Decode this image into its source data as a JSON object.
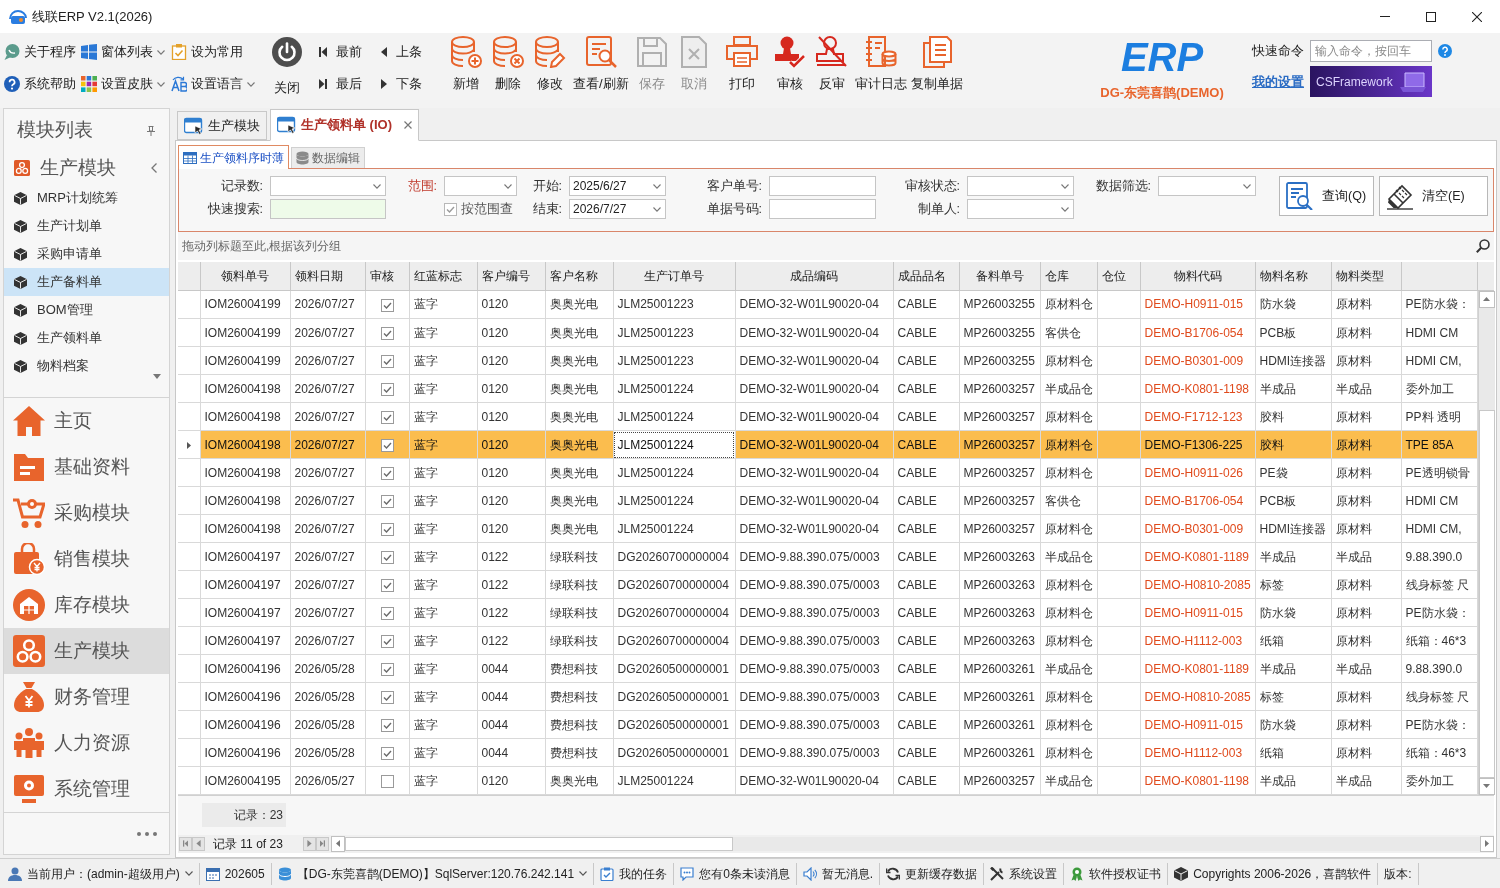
{
  "window": {
    "title": "线联ERP V2.1(2026)"
  },
  "toolbar": {
    "quick_buttons": [
      {
        "label": "关于程序",
        "dropdown": false
      },
      {
        "label": "窗体列表",
        "dropdown": true
      },
      {
        "label": "设为常用",
        "dropdown": false
      },
      {
        "label": "系统帮助",
        "dropdown": false
      },
      {
        "label": "设置皮肤",
        "dropdown": true
      },
      {
        "label": "设置语言",
        "dropdown": true
      }
    ],
    "close_button": {
      "label": "关闭"
    },
    "nav_buttons": [
      {
        "label": "最前"
      },
      {
        "label": "上条"
      },
      {
        "label": "最后"
      },
      {
        "label": "下条"
      }
    ],
    "action_buttons": [
      {
        "label": "新增",
        "disabled": false
      },
      {
        "label": "删除",
        "disabled": false
      },
      {
        "label": "修改",
        "disabled": false
      },
      {
        "label": "查看/刷新",
        "disabled": false
      },
      {
        "label": "保存",
        "disabled": true
      },
      {
        "label": "取消",
        "disabled": true
      },
      {
        "label": "打印",
        "disabled": false
      },
      {
        "label": "审核",
        "disabled": false
      },
      {
        "label": "反审",
        "disabled": false
      },
      {
        "label": "审计日志",
        "disabled": false
      },
      {
        "label": "复制单据",
        "disabled": false
      }
    ]
  },
  "brand": {
    "logo_text": "ERP",
    "company": "DG-东莞喜鹊(DEMO)"
  },
  "quick_command": {
    "label": "快速命令",
    "placeholder": "输入命令，按回车"
  },
  "settings_link": "我的设置",
  "banner": {
    "text": "CSFramework"
  },
  "sidebar": {
    "title": "模块列表",
    "group": {
      "label": "生产模块",
      "expanded": true
    },
    "items": [
      {
        "label": "MRP计划统筹",
        "selected": false
      },
      {
        "label": "生产计划单",
        "selected": false
      },
      {
        "label": "采购申请单",
        "selected": false
      },
      {
        "label": "生产备料单",
        "selected": true
      },
      {
        "label": "BOM管理",
        "selected": false
      },
      {
        "label": "生产领料单",
        "selected": false
      },
      {
        "label": "物料档案",
        "selected": false
      }
    ],
    "modules": [
      {
        "label": "主页",
        "selected": false
      },
      {
        "label": "基础资料",
        "selected": false
      },
      {
        "label": "采购模块",
        "selected": false
      },
      {
        "label": "销售模块",
        "selected": false
      },
      {
        "label": "库存模块",
        "selected": false
      },
      {
        "label": "生产模块",
        "selected": true
      },
      {
        "label": "财务管理",
        "selected": false
      },
      {
        "label": "人力资源",
        "selected": false
      },
      {
        "label": "系统管理",
        "selected": false
      }
    ]
  },
  "document_tabs": [
    {
      "label": "生产模块",
      "selected": false,
      "closable": false
    },
    {
      "label": "生产领料单 (IO)",
      "selected": true,
      "closable": true
    }
  ],
  "view_tabs": [
    {
      "label": "生产领料序时薄",
      "selected": true
    },
    {
      "label": "数据编辑",
      "selected": false
    }
  ],
  "filters": {
    "columns": [
      [
        {
          "kind": "dropdown",
          "label": "记录数:",
          "emphasized": false
        },
        {
          "kind": "search",
          "label": "快速搜索:",
          "emphasized": false
        }
      ],
      [
        {
          "kind": "dropdown",
          "label": "范围:",
          "emphasized": true
        },
        {
          "kind": "checkbox",
          "label": "按范围查",
          "checked": true,
          "disabled": true
        }
      ],
      [
        {
          "kind": "dropdown",
          "label": "开始:",
          "value": "2025/6/27",
          "emphasized": false
        },
        {
          "kind": "dropdown",
          "label": "结束:",
          "value": "2026/7/27",
          "emphasized": false
        }
      ],
      [
        {
          "kind": "text",
          "label": "客户单号:",
          "emphasized": false
        },
        {
          "kind": "text",
          "label": "单据号码:",
          "emphasized": false
        }
      ],
      [
        {
          "kind": "dropdown",
          "label": "审核状态:",
          "emphasized": false
        },
        {
          "kind": "dropdown",
          "label": "制单人:",
          "emphasized": false
        }
      ],
      [
        {
          "kind": "dropdown",
          "label": "数据筛选:",
          "emphasized": false
        }
      ]
    ],
    "buttons": [
      {
        "label": "查询(Q)"
      },
      {
        "label": "清空(E)"
      }
    ]
  },
  "group_panel": {
    "hint": "拖动列标题至此,根据该列分组"
  },
  "table": {
    "columns": [
      {
        "label": "领料单号",
        "focused": false
      },
      {
        "label": "领料日期",
        "focused": false
      },
      {
        "label": "审核",
        "focused": false
      },
      {
        "label": "红蓝标志",
        "focused": false
      },
      {
        "label": "客户编号",
        "focused": false
      },
      {
        "label": "客户名称",
        "focused": false
      },
      {
        "label": "生产订单号",
        "focused": true
      },
      {
        "label": "成品编码",
        "focused": false
      },
      {
        "label": "成品品名",
        "focused": false
      },
      {
        "label": "备料单号",
        "focused": false
      },
      {
        "label": "仓库",
        "focused": false
      },
      {
        "label": "仓位",
        "focused": false
      },
      {
        "label": "物料代码",
        "focused": false
      },
      {
        "label": "物料名称",
        "focused": false
      },
      {
        "label": "物料类型",
        "focused": false
      }
    ],
    "rows": [
      {
        "order_no": "IOM26004199",
        "date": "2026/07/27",
        "audited": true,
        "flag": "蓝字",
        "customer_code": "0120",
        "customer_name": "奥奥光电",
        "production_order": "JLM25001223",
        "product_code": "DEMO-32-W01L90020-04",
        "product_name": "CABLE",
        "prep_no": "MP26003255",
        "warehouse": "原材料仓",
        "material_code": "DEMO-H0911-015",
        "material_name": "防水袋",
        "material_type": "原材料",
        "column_17": "PE防水袋：",
        "selected": false
      },
      {
        "order_no": "IOM26004199",
        "date": "2026/07/27",
        "audited": true,
        "flag": "蓝字",
        "customer_code": "0120",
        "customer_name": "奥奥光电",
        "production_order": "JLM25001223",
        "product_code": "DEMO-32-W01L90020-04",
        "product_name": "CABLE",
        "prep_no": "MP26003255",
        "warehouse": "客供仓",
        "material_code": "DEMO-B1706-054",
        "material_name": "PCB板",
        "material_type": "原材料",
        "column_17": "HDMI CM",
        "selected": false
      },
      {
        "order_no": "IOM26004199",
        "date": "2026/07/27",
        "audited": true,
        "flag": "蓝字",
        "customer_code": "0120",
        "customer_name": "奥奥光电",
        "production_order": "JLM25001223",
        "product_code": "DEMO-32-W01L90020-04",
        "product_name": "CABLE",
        "prep_no": "MP26003255",
        "warehouse": "原材料仓",
        "material_code": "DEMO-B0301-009",
        "material_name": "HDMI连接器",
        "material_type": "原材料",
        "column_17": "HDMI CM,",
        "selected": false
      },
      {
        "order_no": "IOM26004198",
        "date": "2026/07/27",
        "audited": true,
        "flag": "蓝字",
        "customer_code": "0120",
        "customer_name": "奥奥光电",
        "production_order": "JLM25001224",
        "product_code": "DEMO-32-W01L90020-04",
        "product_name": "CABLE",
        "prep_no": "MP26003257",
        "warehouse": "半成品仓",
        "material_code": "DEMO-K0801-1198",
        "material_name": "半成品",
        "material_type": "半成品",
        "column_17": "委外加工",
        "selected": false
      },
      {
        "order_no": "IOM26004198",
        "date": "2026/07/27",
        "audited": true,
        "flag": "蓝字",
        "customer_code": "0120",
        "customer_name": "奥奥光电",
        "production_order": "JLM25001224",
        "product_code": "DEMO-32-W01L90020-04",
        "product_name": "CABLE",
        "prep_no": "MP26003257",
        "warehouse": "原材料仓",
        "material_code": "DEMO-F1712-123",
        "material_name": "胶料",
        "material_type": "原材料",
        "column_17": "PP料 透明",
        "selected": false
      },
      {
        "order_no": "IOM26004198",
        "date": "2026/07/27",
        "audited": true,
        "flag": "蓝字",
        "customer_code": "0120",
        "customer_name": "奥奥光电",
        "production_order": "JLM25001224",
        "product_code": "DEMO-32-W01L90020-04",
        "product_name": "CABLE",
        "prep_no": "MP26003257",
        "warehouse": "原材料仓",
        "material_code": "DEMO-F1306-225",
        "material_name": "胶料",
        "material_type": "原材料",
        "column_17": "TPE 85A",
        "selected": true
      },
      {
        "order_no": "IOM26004198",
        "date": "2026/07/27",
        "audited": true,
        "flag": "蓝字",
        "customer_code": "0120",
        "customer_name": "奥奥光电",
        "production_order": "JLM25001224",
        "product_code": "DEMO-32-W01L90020-04",
        "product_name": "CABLE",
        "prep_no": "MP26003257",
        "warehouse": "原材料仓",
        "material_code": "DEMO-H0911-026",
        "material_name": "PE袋",
        "material_type": "原材料",
        "column_17": "PE透明锁骨",
        "selected": false
      },
      {
        "order_no": "IOM26004198",
        "date": "2026/07/27",
        "audited": true,
        "flag": "蓝字",
        "customer_code": "0120",
        "customer_name": "奥奥光电",
        "production_order": "JLM25001224",
        "product_code": "DEMO-32-W01L90020-04",
        "product_name": "CABLE",
        "prep_no": "MP26003257",
        "warehouse": "客供仓",
        "material_code": "DEMO-B1706-054",
        "material_name": "PCB板",
        "material_type": "原材料",
        "column_17": "HDMI CM",
        "selected": false
      },
      {
        "order_no": "IOM26004198",
        "date": "2026/07/27",
        "audited": true,
        "flag": "蓝字",
        "customer_code": "0120",
        "customer_name": "奥奥光电",
        "production_order": "JLM25001224",
        "product_code": "DEMO-32-W01L90020-04",
        "product_name": "CABLE",
        "prep_no": "MP26003257",
        "warehouse": "原材料仓",
        "material_code": "DEMO-B0301-009",
        "material_name": "HDMI连接器",
        "material_type": "原材料",
        "column_17": "HDMI CM,",
        "selected": false
      },
      {
        "order_no": "IOM26004197",
        "date": "2026/07/27",
        "audited": true,
        "flag": "蓝字",
        "customer_code": "0122",
        "customer_name": "绿联科技",
        "production_order": "DG20260700000004",
        "product_code": "DEMO-9.88.390.075/0003",
        "product_name": "CABLE",
        "prep_no": "MP26003263",
        "warehouse": "半成品仓",
        "material_code": "DEMO-K0801-1189",
        "material_name": "半成品",
        "material_type": "半成品",
        "column_17": "9.88.390.0",
        "selected": false
      },
      {
        "order_no": "IOM26004197",
        "date": "2026/07/27",
        "audited": true,
        "flag": "蓝字",
        "customer_code": "0122",
        "customer_name": "绿联科技",
        "production_order": "DG20260700000004",
        "product_code": "DEMO-9.88.390.075/0003",
        "product_name": "CABLE",
        "prep_no": "MP26003263",
        "warehouse": "原材料仓",
        "material_code": "DEMO-H0810-2085",
        "material_name": "标签",
        "material_type": "原材料",
        "column_17": "线身标签 尺",
        "selected": false
      },
      {
        "order_no": "IOM26004197",
        "date": "2026/07/27",
        "audited": true,
        "flag": "蓝字",
        "customer_code": "0122",
        "customer_name": "绿联科技",
        "production_order": "DG20260700000004",
        "product_code": "DEMO-9.88.390.075/0003",
        "product_name": "CABLE",
        "prep_no": "MP26003263",
        "warehouse": "原材料仓",
        "material_code": "DEMO-H0911-015",
        "material_name": "防水袋",
        "material_type": "原材料",
        "column_17": "PE防水袋：",
        "selected": false
      },
      {
        "order_no": "IOM26004197",
        "date": "2026/07/27",
        "audited": true,
        "flag": "蓝字",
        "customer_code": "0122",
        "customer_name": "绿联科技",
        "production_order": "DG20260700000004",
        "product_code": "DEMO-9.88.390.075/0003",
        "product_name": "CABLE",
        "prep_no": "MP26003263",
        "warehouse": "原材料仓",
        "material_code": "DEMO-H1112-003",
        "material_name": "纸箱",
        "material_type": "原材料",
        "column_17": "纸箱：46*3",
        "selected": false
      },
      {
        "order_no": "IOM26004196",
        "date": "2026/05/28",
        "audited": true,
        "flag": "蓝字",
        "customer_code": "0044",
        "customer_name": "费想科技",
        "production_order": "DG20260500000001",
        "product_code": "DEMO-9.88.390.075/0003",
        "product_name": "CABLE",
        "prep_no": "MP26003261",
        "warehouse": "半成品仓",
        "material_code": "DEMO-K0801-1189",
        "material_name": "半成品",
        "material_type": "半成品",
        "column_17": "9.88.390.0",
        "selected": false
      },
      {
        "order_no": "IOM26004196",
        "date": "2026/05/28",
        "audited": true,
        "flag": "蓝字",
        "customer_code": "0044",
        "customer_name": "费想科技",
        "production_order": "DG20260500000001",
        "product_code": "DEMO-9.88.390.075/0003",
        "product_name": "CABLE",
        "prep_no": "MP26003261",
        "warehouse": "原材料仓",
        "material_code": "DEMO-H0810-2085",
        "material_name": "标签",
        "material_type": "原材料",
        "column_17": "线身标签 尺",
        "selected": false
      },
      {
        "order_no": "IOM26004196",
        "date": "2026/05/28",
        "audited": true,
        "flag": "蓝字",
        "customer_code": "0044",
        "customer_name": "费想科技",
        "production_order": "DG20260500000001",
        "product_code": "DEMO-9.88.390.075/0003",
        "product_name": "CABLE",
        "prep_no": "MP26003261",
        "warehouse": "原材料仓",
        "material_code": "DEMO-H0911-015",
        "material_name": "防水袋",
        "material_type": "原材料",
        "column_17": "PE防水袋：",
        "selected": false
      },
      {
        "order_no": "IOM26004196",
        "date": "2026/05/28",
        "audited": true,
        "flag": "蓝字",
        "customer_code": "0044",
        "customer_name": "费想科技",
        "production_order": "DG20260500000001",
        "product_code": "DEMO-9.88.390.075/0003",
        "product_name": "CABLE",
        "prep_no": "MP26003261",
        "warehouse": "原材料仓",
        "material_code": "DEMO-H1112-003",
        "material_name": "纸箱",
        "material_type": "原材料",
        "column_17": "纸箱：46*3",
        "selected": false
      },
      {
        "order_no": "IOM26004195",
        "date": "2026/05/27",
        "audited": false,
        "flag": "蓝字",
        "customer_code": "0120",
        "customer_name": "奥奥光电",
        "production_order": "JLM25001224",
        "product_code": "DEMO-32-W01L90020-04",
        "product_name": "CABLE",
        "prep_no": "MP26003257",
        "warehouse": "半成品仓",
        "material_code": "DEMO-K0801-1198",
        "material_name": "半成品",
        "material_type": "半成品",
        "column_17": "委外加工",
        "selected": false
      }
    ],
    "footer": {
      "summary": "记录：23"
    }
  },
  "navigator": {
    "text": "记录 11 of 23"
  },
  "status_bar": [
    {
      "text": "当前用户：(admin-超级用户)",
      "dropdown": true
    },
    {
      "text": "202605",
      "dropdown": false
    },
    {
      "text": "【DG-东莞喜鹊(DEMO)】SqlServer:120.76.242.141",
      "dropdown": true
    },
    {
      "text": "我的任务",
      "dropdown": false
    },
    {
      "text": "您有0条未读消息",
      "dropdown": false
    },
    {
      "text": "暂无消息.",
      "dropdown": false
    },
    {
      "text": "更新缓存数据",
      "dropdown": false
    },
    {
      "text": "系统设置",
      "dropdown": false
    },
    {
      "text": "软件授权证书",
      "dropdown": false
    },
    {
      "text": "Copyrights 2006-2026，喜鹊软件",
      "dropdown": false
    },
    {
      "text": "版本:",
      "dropdown": false
    }
  ]
}
